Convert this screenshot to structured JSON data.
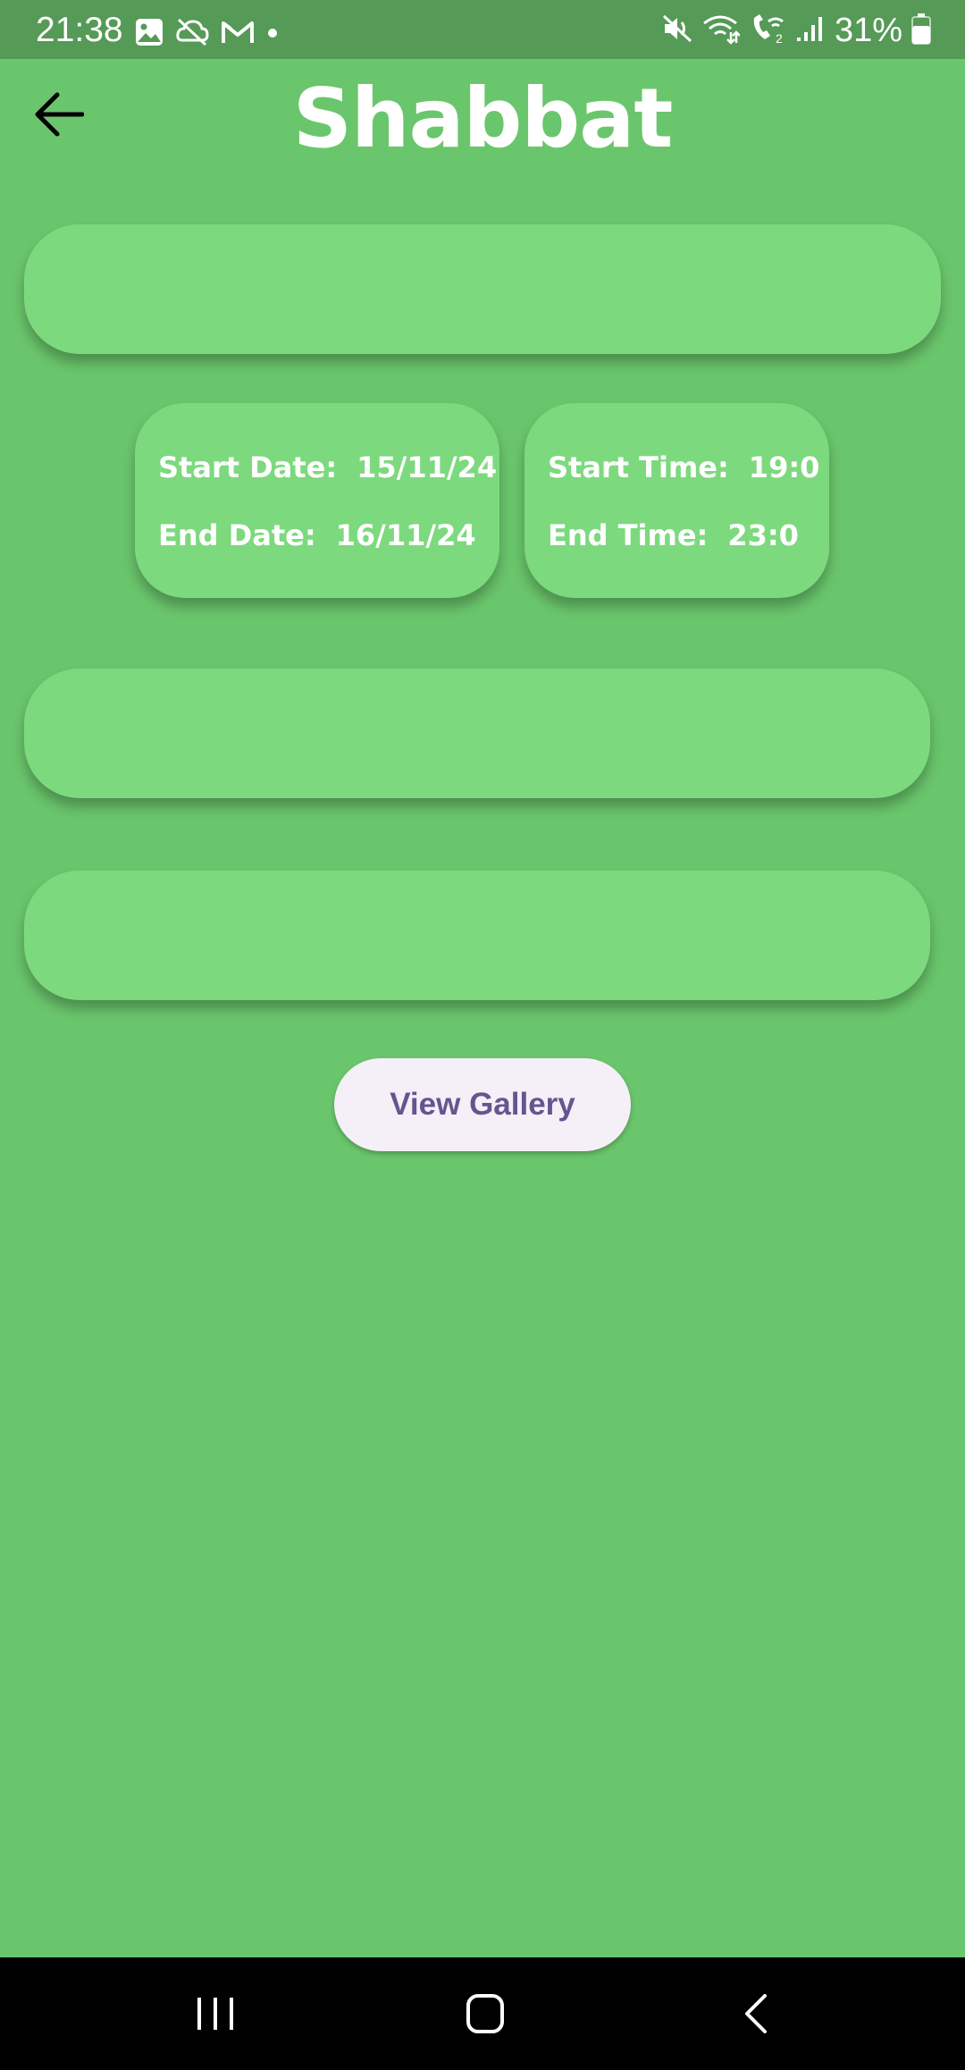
{
  "status_bar": {
    "time": "21:38",
    "left_icons": [
      "gallery-icon",
      "cloud-off-icon",
      "gmail-icon",
      "dot-icon"
    ],
    "right_icons": [
      "mute-icon",
      "wifi-calling-icon",
      "wifi-call-icon",
      "signal-icon",
      "battery-icon"
    ],
    "battery_percent": "31%"
  },
  "header": {
    "back_icon": "arrow-left-icon",
    "title": "Shabbat"
  },
  "dates": {
    "start_label": "Start Date:",
    "start_value": "15/11/24",
    "end_label": "End Date:",
    "end_value": "16/11/24"
  },
  "times": {
    "start_label": "Start Time:",
    "start_value": "19:0",
    "end_label": "End Time:",
    "end_value": "23:0"
  },
  "gallery_button": {
    "label": "View Gallery"
  },
  "nav_bar": {
    "icons": [
      "recents-icon",
      "home-icon",
      "back-icon"
    ]
  },
  "colors": {
    "background": "#6ac66c",
    "status_bar": "#559a56",
    "card": "#7dd97e",
    "button_bg": "#f5eff7",
    "button_text": "#65558f",
    "nav_bar": "#000000"
  }
}
